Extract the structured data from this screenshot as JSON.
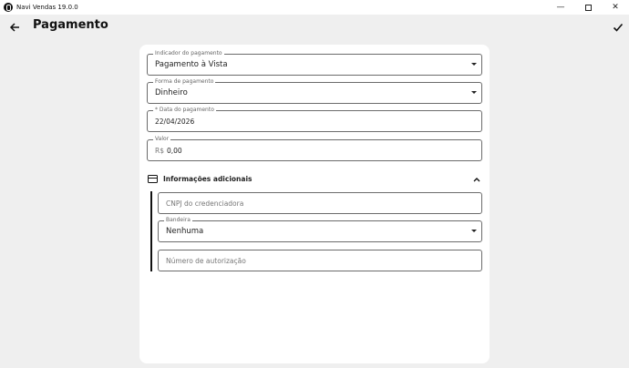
{
  "window": {
    "title": "Navi Vendas 19.0.0",
    "minimize_glyph": "—",
    "close_glyph": "✕"
  },
  "header": {
    "title": "Pagamento"
  },
  "form": {
    "indicador": {
      "label": "Indicador do pagamento",
      "value": "Pagamento à Vista"
    },
    "forma": {
      "label": "Forma de pagamento",
      "value": "Dinheiro"
    },
    "data": {
      "label": "* Data do pagamento",
      "value": "22/04/2026"
    },
    "valor": {
      "label": "Valor",
      "prefix": "R$",
      "value": "0,00"
    }
  },
  "additional": {
    "title": "Informações adicionais",
    "cnpj": {
      "placeholder": "CNPJ do credenciadora"
    },
    "bandeira": {
      "label": "Bandeira",
      "value": "Nenhuma"
    },
    "autorizacao": {
      "placeholder": "Número de autorização"
    }
  },
  "icons": {
    "app": "app-logo-icon",
    "back": "arrow-left-icon",
    "confirm": "check-icon",
    "section": "credit-card-icon",
    "collapse": "chevron-up-icon",
    "dropdown": "caret-down-icon"
  }
}
